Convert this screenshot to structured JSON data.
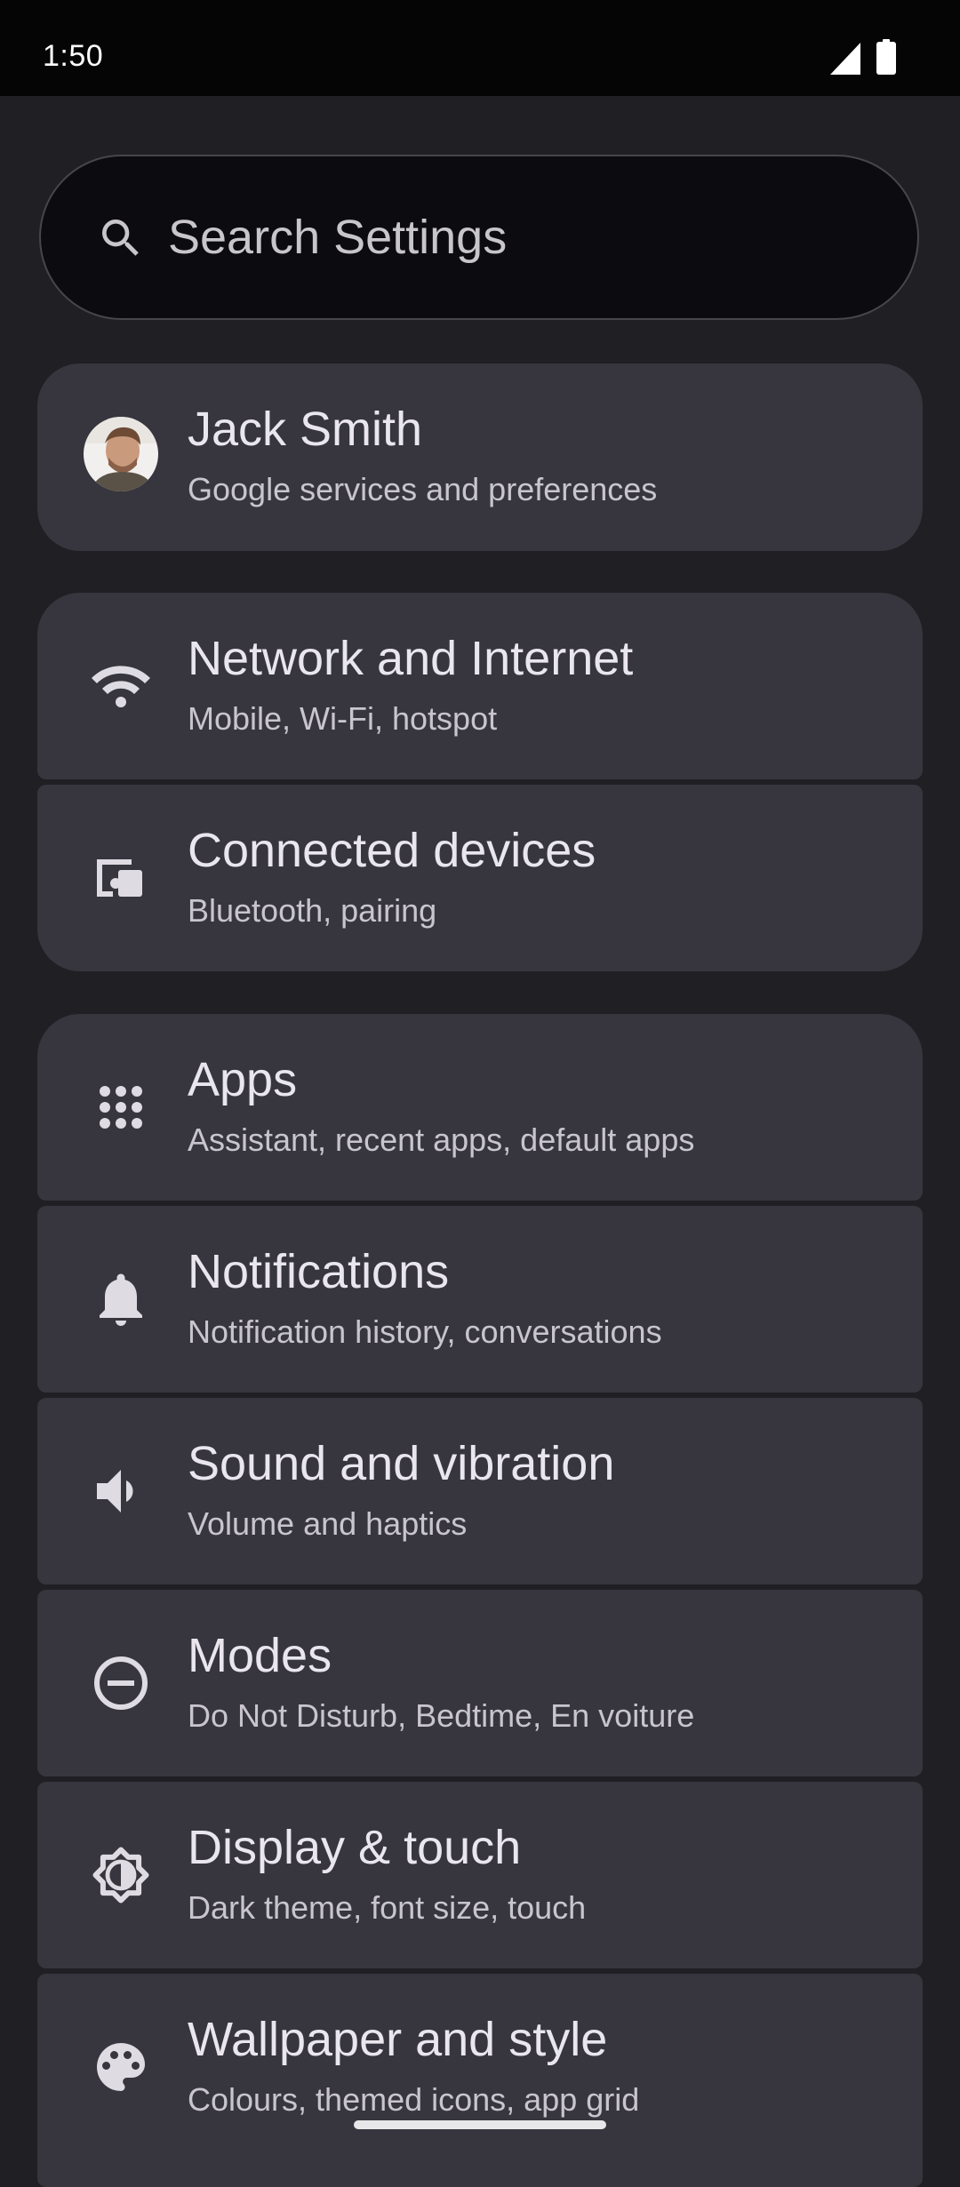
{
  "status_bar": {
    "time": "1:50",
    "signal_icon": "cell-signal-icon",
    "battery_icon": "battery-icon"
  },
  "search": {
    "placeholder": "Search Settings",
    "icon": "search-icon"
  },
  "account": {
    "name": "Jack Smith",
    "subtitle": "Google services and preferences",
    "avatar": "avatar-photo"
  },
  "items": [
    {
      "title": "Network and Internet",
      "subtitle": "Mobile, Wi-Fi, hotspot",
      "icon": "wifi-icon"
    },
    {
      "title": "Connected devices",
      "subtitle": "Bluetooth, pairing",
      "icon": "connected-devices-icon"
    },
    {
      "title": "Apps",
      "subtitle": "Assistant, recent apps, default apps",
      "icon": "apps-grid-icon"
    },
    {
      "title": "Notifications",
      "subtitle": "Notification history, conversations",
      "icon": "bell-icon"
    },
    {
      "title": "Sound and vibration",
      "subtitle": "Volume and haptics",
      "icon": "speaker-icon"
    },
    {
      "title": "Modes",
      "subtitle": "Do Not Disturb, Bedtime, En voiture",
      "icon": "do-not-disturb-icon"
    },
    {
      "title": "Display & touch",
      "subtitle": "Dark theme, font size, touch",
      "icon": "brightness-icon"
    },
    {
      "title": "Wallpaper and style",
      "subtitle": "Colours, themed icons, app grid",
      "icon": "palette-icon"
    }
  ],
  "colors": {
    "background": "#1f1f24",
    "card": "#37363e",
    "search_field": "#0c0c10",
    "text_primary": "#eae6ee",
    "text_secondary": "#c9c5cd"
  }
}
